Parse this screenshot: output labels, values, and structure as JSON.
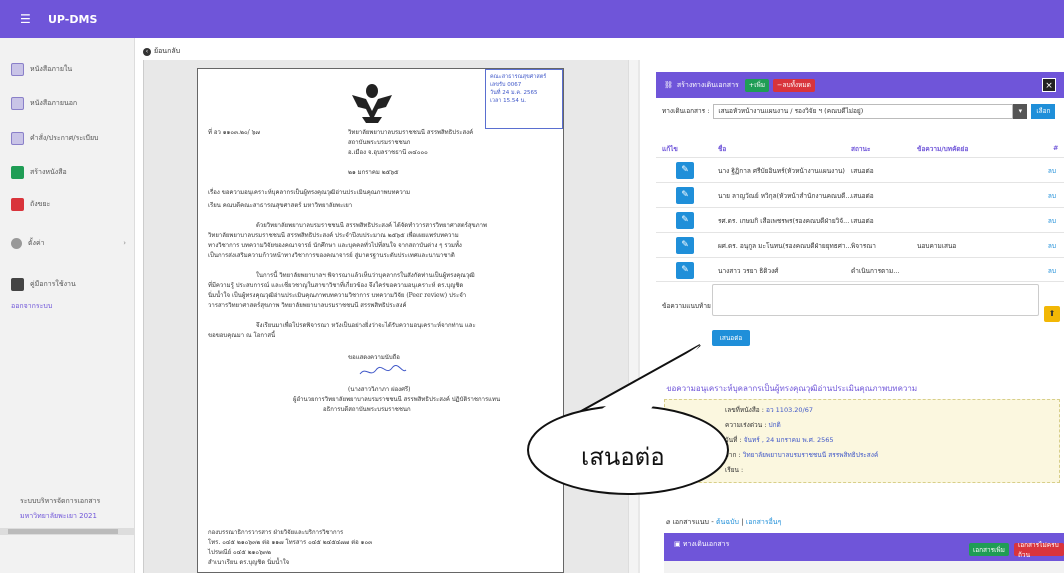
{
  "app": {
    "title": "UP-DMS"
  },
  "sidebar": {
    "items": [
      {
        "label": "หนังสือภายใน",
        "icon": "doc-icon"
      },
      {
        "label": "หนังสือภายนอก",
        "icon": "doc-icon"
      },
      {
        "label": "คำสั่ง/ประกาศ/ระเบียบ",
        "icon": "doc-icon"
      },
      {
        "label": "สร้างหนังสือ",
        "icon": "create-icon"
      },
      {
        "label": "ถังขยะ",
        "icon": "trash-icon"
      },
      {
        "label": "ตั้งค่า",
        "icon": "gear-icon"
      },
      {
        "label": "คู่มือการใช้งาน",
        "icon": "book-icon"
      },
      {
        "label": "ออกจากระบบ",
        "icon": ""
      }
    ],
    "footer_line1": "ระบบบริหารจัดการเอกสาร",
    "footer_line2": "มหาวิทยาลัยพะเยา 2021"
  },
  "back": {
    "label": "ย้อนกลับ"
  },
  "document": {
    "stamp": [
      "คณะสาธารณสุขศาสตร์",
      "เลขรับ 0067",
      "วันที่ 24 ม.ค. 2565",
      "เวลา 15.54 น."
    ],
    "lines": [
      "ที่ อว ๑๑๐๓.๒๐/ ๖๗",
      "วิทยาลัยพยาบาลบรมราชชนนี สรรพสิทธิประสงค์",
      "สถาบันพระบรมราชชนก",
      "อ.เมือง จ.อุบลราชธานี ๓๔๐๐๐",
      "๒๑ มกราคม ๒๕๖๕",
      "เรื่อง  ขอความอนุเคราะห์บุคลากรเป็นผู้ทรงคุณวุฒิอ่านประเมินคุณภาพบทความ",
      "เรียน  คณบดีคณะสาธารณสุขศาสตร์ มหาวิทยาลัยพะเยา",
      "ด้วยวิทยาลัยพยาบาลบรมราชชนนี สรรพสิทธิประสงค์ ได้จัดทำวารสารวิทยาศาสตร์สุขภาพ",
      "วิทยาลัยพยาบาลบรมราชชนนี สรรพสิทธิประสงค์ ประจำปีงบประมาณ ๒๕๖๕ เพื่อเผยแพร่บทความ",
      "ทางวิชาการ บทความวิจัยของคณาจารย์ นักศึกษา และบุคคลทั่วไปที่สนใจ จากสถาบันต่าง ๆ รวมทั้ง",
      "เป็นการส่งเสริมความก้าวหน้าทางวิชาการของคณาจารย์ สู่มาตรฐานระดับประเทศและนานาชาติ",
      "ในการนี้ วิทยาลัยพยาบาลฯ พิจารณาแล้วเห็นว่าบุคลากรในสังกัดท่านเป็นผู้ทรงคุณวุฒิ",
      "ที่มีความรู้ ประสบการณ์ และเชี่ยวชาญในสาขาวิชาที่เกี่ยวข้อง จึงใคร่ขอความอนุเคราะห์ ดร.บุญชิด",
      "นิ่มน้ำใจ เป็นผู้ทรงคุณวุฒิอ่านประเมินคุณภาพบทความวิชาการ บทความวิจัย (Peer review) ประจำ",
      "วารสารวิทยาศาสตร์สุขภาพ วิทยาลัยพยาบาลบรมราชชนนี สรรพสิทธิประสงค์",
      "จึงเรียนมาเพื่อโปรดพิจารณา หวังเป็นอย่างยิ่งว่าจะได้รับความอนุเคราะห์จากท่าน และ",
      "ขอขอบคุณมา ณ โอกาสนี้",
      "ขอแสดงความนับถือ",
      "(นางสาววิภาภา ผ่องศรี)",
      "ผู้อำนวยการวิทยาลัยพยาบาลบรมราชชนนี สรรพสิทธิประสงค์ ปฏิบัติราชการแทน",
      "อธิการบดีสถาบันพระบรมราชชนก",
      "กองบรรณาธิการวารสาร ฝ่ายวิจัยและบริการวิชาการ",
      "โทร. ๐๔๕ ๒๑๐๖๓๒ ต่อ ๑๑๗ โทรสาร ๐๔๕ ๒๔๕๔๗๗ ต่อ ๑๐๓",
      "ไปรษณีย์ ๐๔๕ ๒๑๐๖๓๒",
      "สำเนาเรียน ดร.บุญชิด นิ่มน้ำใจ"
    ]
  },
  "panel": {
    "title": "สร้างทางเดินเอกสาร",
    "add_label": "เพิ่ม",
    "delete_all_label": "ลบทั้งหมด",
    "route_label": "ทางเดินเอกสาร :",
    "route_value": "เสนอหัวหน้างานแผนงาน / รองวิจัย ฯ (คณบดีไม่อยู่)",
    "route_button": "เลือก",
    "columns": [
      "แก้ไข",
      "ชื่อ",
      "สถานะ",
      "ข้อความ/บทคัดย่อ",
      "#"
    ],
    "rows": [
      {
        "name": "นาง ฐิฏิกาล ศรีบัยอินทร์(หัวหน้างานแผนงาน)",
        "status": "เสนอต่อ",
        "msg": "",
        "del": "ลบ"
      },
      {
        "name": "นาย ลาญวัณย์ หวิกุล(หัวหน้าสำนักงานคณบดี...",
        "status": "เสนอต่อ",
        "msg": "",
        "del": "ลบ"
      },
      {
        "name": "รศ.ดร. เกษมกิ เสือเพชรพร(รองคณบดีฝ่ายวิจั...",
        "status": "เสนอต่อ",
        "msg": "",
        "del": "ลบ"
      },
      {
        "name": "ผศ.ดร. อนุกูล มะโนทน(รองคณบดีฝ่ายยุทธศา...",
        "status": "พิจารณา",
        "msg": "นอบคามเสนอ",
        "del": "ลบ"
      },
      {
        "name": "นางสาว วรยา ธิติวงศ์",
        "status": "ดำเนินการตาม...",
        "msg": "",
        "del": "ลบ"
      }
    ],
    "message_label": "ข้อความแนบท้าย",
    "submit_label": "เสนอต่อ",
    "info_title": "ขอความอนุเคราะห์บุคลากรเป็นผู้ทรงคุณวุฒิอ่านประเมินคุณภาพบทความ",
    "info": [
      {
        "label": "เลขที่หนังสือ :",
        "value": "อว 1103.20/67"
      },
      {
        "label": "ความเร่งด่วน :",
        "value": "ปกติ"
      },
      {
        "label": "วันที่ :",
        "value": "จันทร์ , 24 มกราคม พ.ศ. 2565"
      },
      {
        "label": "จาก :",
        "value": "วิทยาลัยพยาบาลบรมราชชนนี สรรพสิทธิประสงค์"
      },
      {
        "label": "เรียน :",
        "value": ""
      }
    ],
    "attachments_label": "เอกสารแนบ",
    "attach_original": "ต้นฉบับ",
    "attach_other": "เอกสารอื่นๆ",
    "route_section_label": "ทางเดินเอกสาร",
    "route_add_label": "เอกสารเพิ่ม",
    "route_add2_label": "เอกสารไม่ครบถ้วน"
  },
  "callout": {
    "text": "เสนอต่อ"
  }
}
